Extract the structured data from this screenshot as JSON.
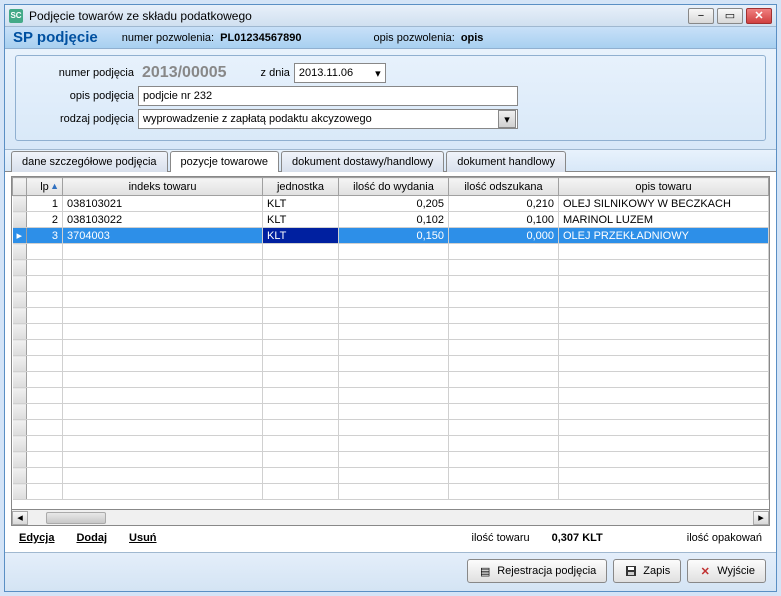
{
  "window_title": "Podjęcie towarów ze składu podatkowego",
  "header": {
    "sp_label": "SP podjęcie",
    "permit_no_label": "numer pozwolenia:",
    "permit_no": "PL01234567890",
    "permit_desc_label": "opis pozwolenia:",
    "permit_desc": "opis"
  },
  "form": {
    "withdraw_no_label": "numer podjęcia",
    "withdraw_no": "2013/00005",
    "date_label": "z dnia",
    "date": "2013.11.06",
    "desc_label": "opis podjęcia",
    "desc": "podjcie nr 232",
    "type_label": "rodzaj podjęcia",
    "type": "wyprowadzenie z zapłatą podaktu akcyzowego"
  },
  "tabs": [
    "dane szczegółowe podjęcia",
    "pozycje towarowe",
    "dokument dostawy/handlowy",
    "dokument handlowy"
  ],
  "grid": {
    "columns": [
      "lp",
      "indeks towaru",
      "jednostka",
      "ilość do wydania",
      "ilość odszukana",
      "opis towaru"
    ],
    "rows": [
      {
        "lp": "1",
        "idx": "038103021",
        "unit": "KLT",
        "qout": "0,205",
        "qfound": "0,210",
        "desc": "OLEJ SILNIKOWY W BECZKACH"
      },
      {
        "lp": "2",
        "idx": "038103022",
        "unit": "KLT",
        "qout": "0,102",
        "qfound": "0,100",
        "desc": "MARINOL LUZEM"
      },
      {
        "lp": "3",
        "idx": "3704003",
        "unit": "KLT",
        "qout": "0,150",
        "qfound": "0,000",
        "desc": "OLEJ PRZEKŁADNIOWY"
      }
    ]
  },
  "actions": {
    "edit": "Edycja",
    "add": "Dodaj",
    "remove": "Usuń",
    "qty_label": "ilość towaru",
    "qty_val": "0,307 KLT",
    "pack_label": "ilość opakowań"
  },
  "footer": {
    "register": "Rejestracja podjęcia",
    "save": "Zapis",
    "exit": "Wyjście"
  }
}
